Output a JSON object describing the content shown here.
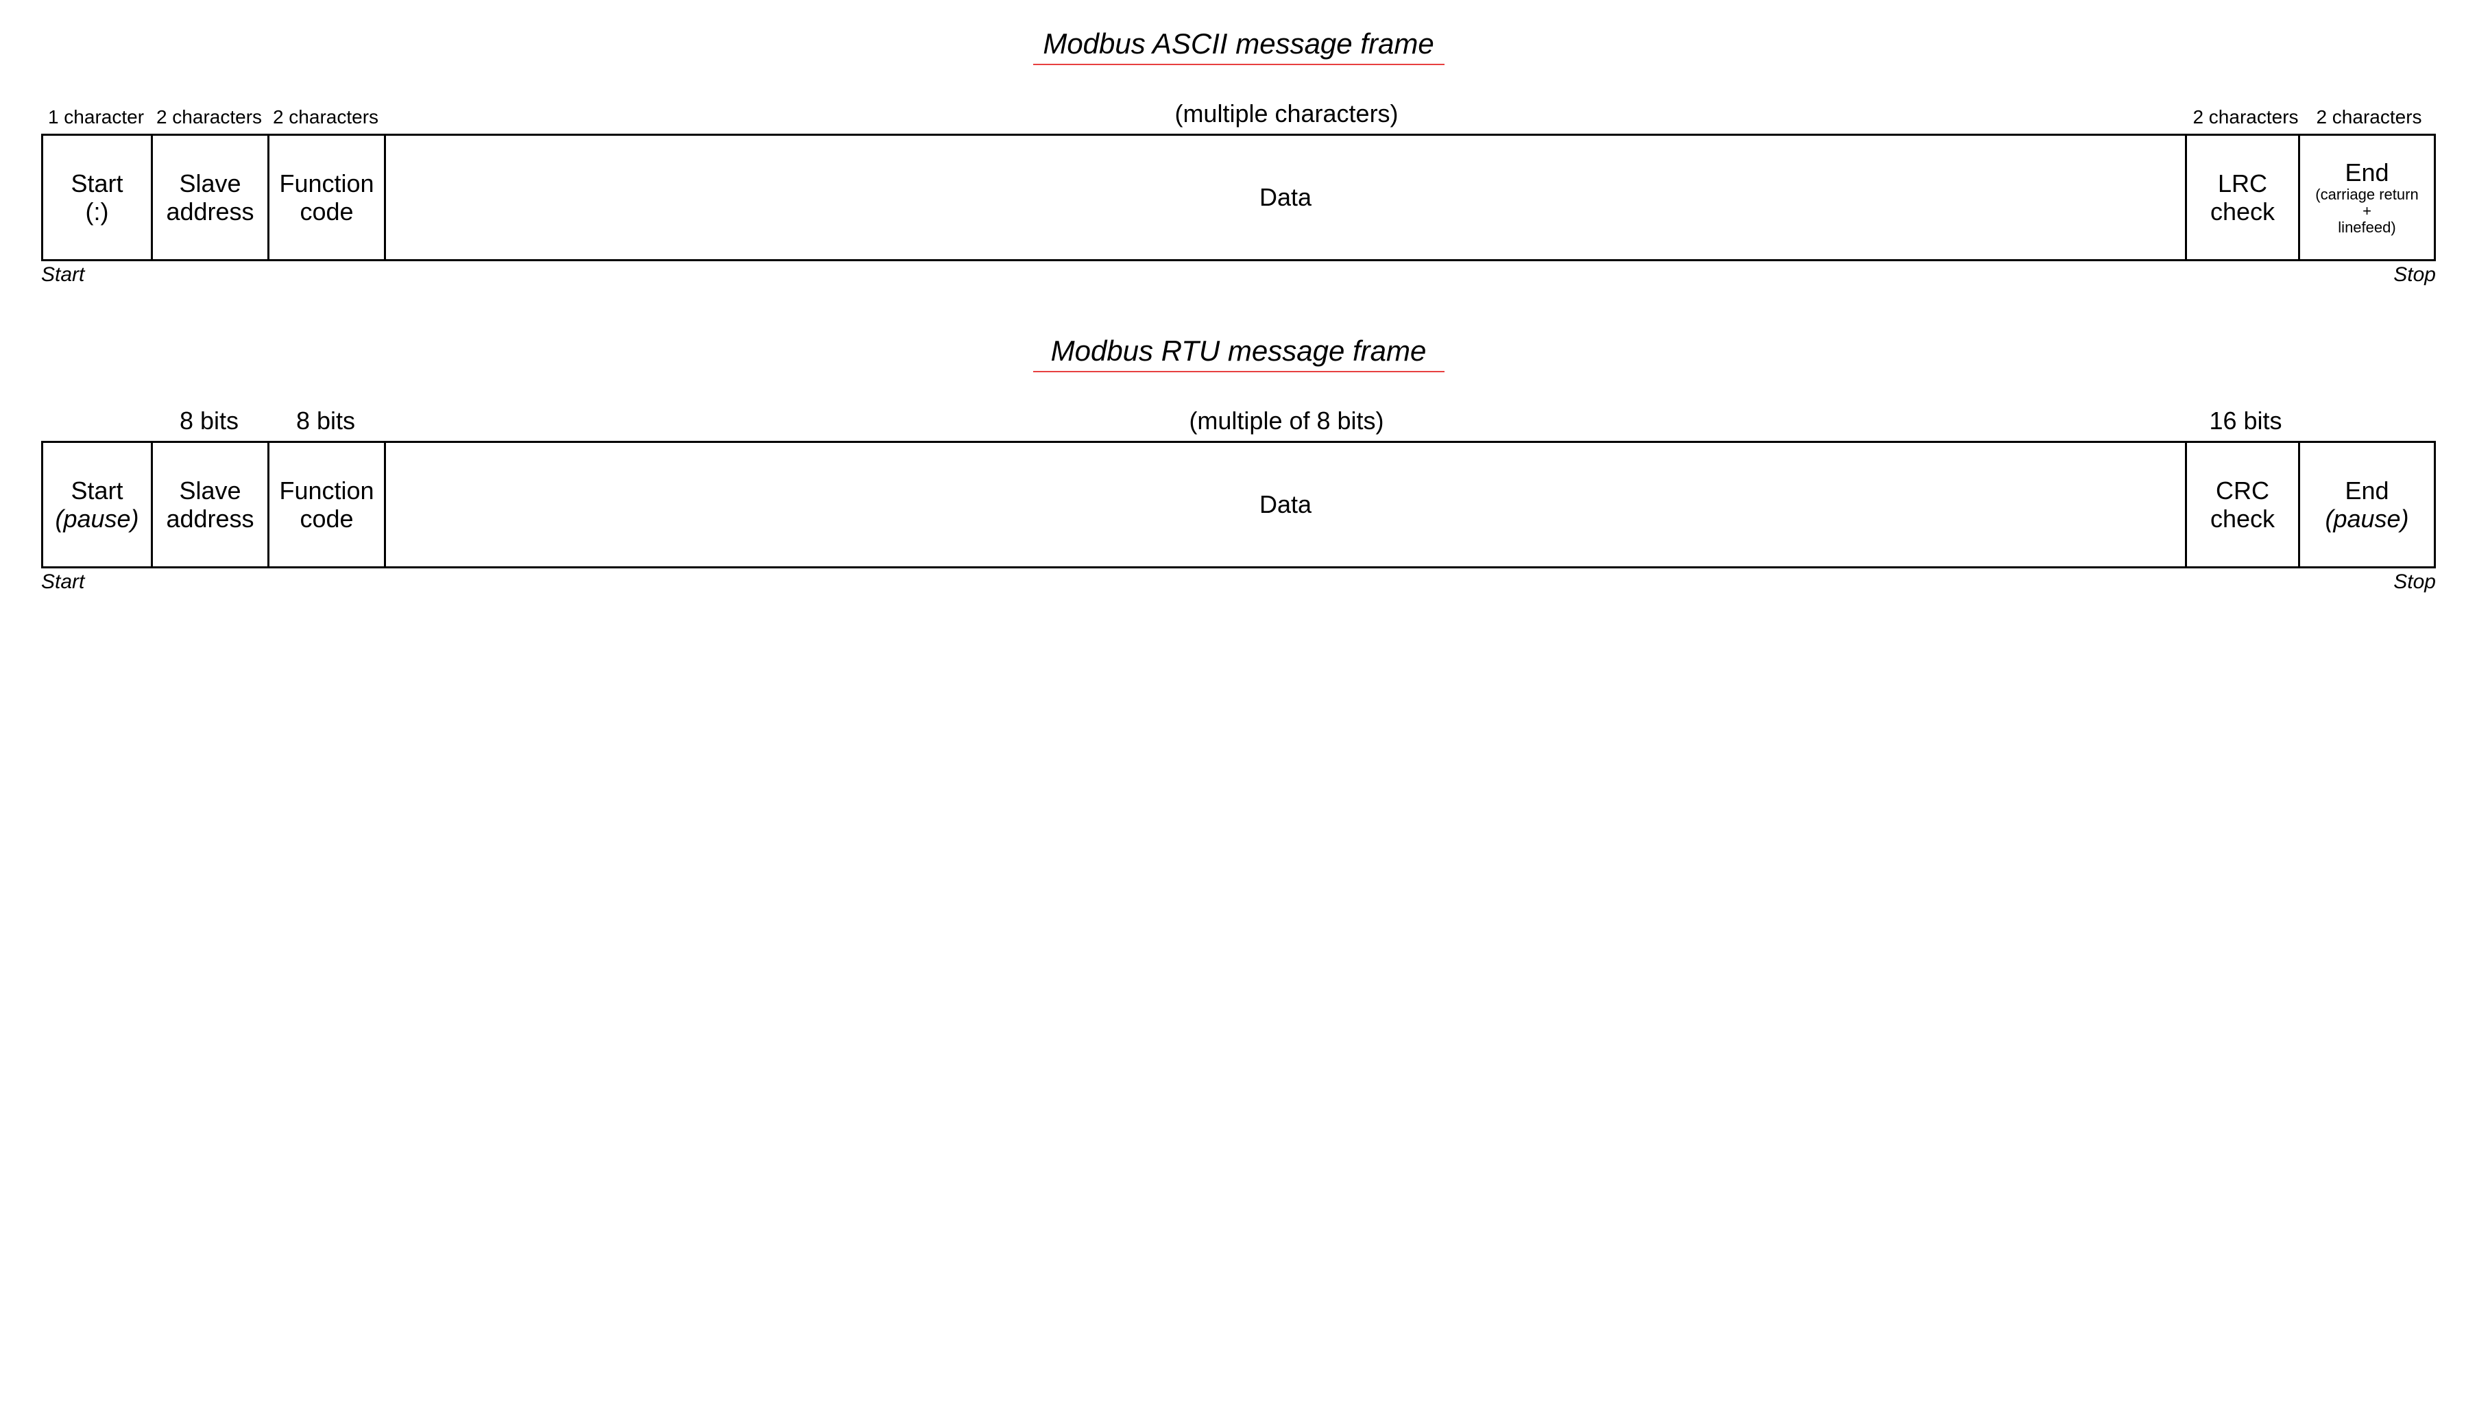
{
  "ascii": {
    "title": "Modbus ASCII message frame",
    "sizes": {
      "start": "1 character",
      "addr": "2 characters",
      "func": "2 characters",
      "data": "(multiple characters)",
      "check": "2 characters",
      "end": "2 characters"
    },
    "fields": {
      "start_l1": "Start",
      "start_l2": "(:)",
      "addr_l1": "Slave",
      "addr_l2": "address",
      "func_l1": "Function",
      "func_l2": "code",
      "data": "Data",
      "check_l1": "LRC",
      "check_l2": "check",
      "end_l1": "End",
      "end_l2": "(carriage return",
      "end_l3": "+",
      "end_l4": "linefeed)"
    },
    "marker_start": "Start",
    "marker_stop": "Stop"
  },
  "rtu": {
    "title": "Modbus RTU message frame",
    "sizes": {
      "start": "",
      "addr": "8 bits",
      "func": "8 bits",
      "data": "(multiple of 8 bits)",
      "check": "16 bits",
      "end": ""
    },
    "fields": {
      "start_l1": "Start",
      "start_l2": "(pause)",
      "addr_l1": "Slave",
      "addr_l2": "address",
      "func_l1": "Function",
      "func_l2": "code",
      "data": "Data",
      "check_l1": "CRC",
      "check_l2": "check",
      "end_l1": "End",
      "end_l2": "(pause)"
    },
    "marker_start": "Start",
    "marker_stop": "Stop"
  }
}
